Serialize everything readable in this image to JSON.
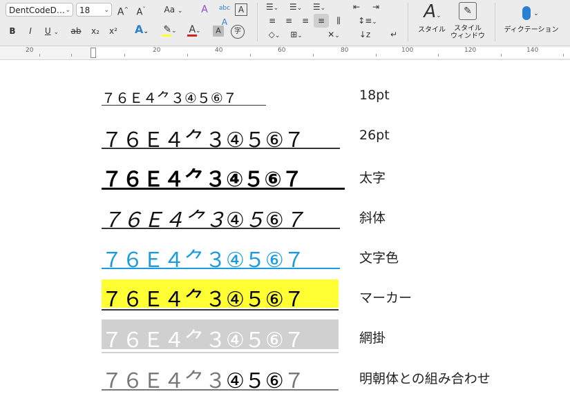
{
  "toolbar": {
    "font_name": "DentCodeD…",
    "font_size": "18",
    "grow_icon": "A^",
    "shrink_icon": "Aˇ",
    "case_label": "Aa",
    "bold": "B",
    "italic": "I",
    "underline": "U",
    "strike": "ab",
    "subscript": "x₂",
    "superscript": "x²",
    "styles_label": "スタイル",
    "styles_pane_label_1": "スタイル",
    "styles_pane_label_2": "ウィンドウ",
    "dictation_label": "ディクテーション"
  },
  "ruler": {
    "labels": [
      "20",
      "20",
      "40",
      "60",
      "80",
      "100",
      "120",
      "140"
    ]
  },
  "samples": [
    {
      "text": "７６Ｅ４⺈３④５⑥７",
      "label": "18pt"
    },
    {
      "text": "７６Ｅ４⺈３④５⑥７",
      "label": "26pt"
    },
    {
      "text": "７６Ｅ４⺈３④５⑥７",
      "label": "太字"
    },
    {
      "text": "７６Ｅ４⺈３④５⑥７",
      "label": "斜体"
    },
    {
      "text": "７６Ｅ４⺈３④５⑥７",
      "label": "文字色"
    },
    {
      "text": "７６Ｅ４⺈３④５⑥７",
      "label": "マーカー"
    },
    {
      "text": "７６Ｅ４⺈３④５⑥７",
      "label": "網掛"
    },
    {
      "text_serif": "７６Ｅ４⺈３",
      "text_sans": "④５⑥",
      "text_serif_end": "７",
      "label": "明朝体との組み合わせ"
    }
  ],
  "colors": {
    "font_color": "#1a9be0",
    "highlight": "#ffff33",
    "shading": "#d0d0d0",
    "serif_gray": "#777777"
  }
}
